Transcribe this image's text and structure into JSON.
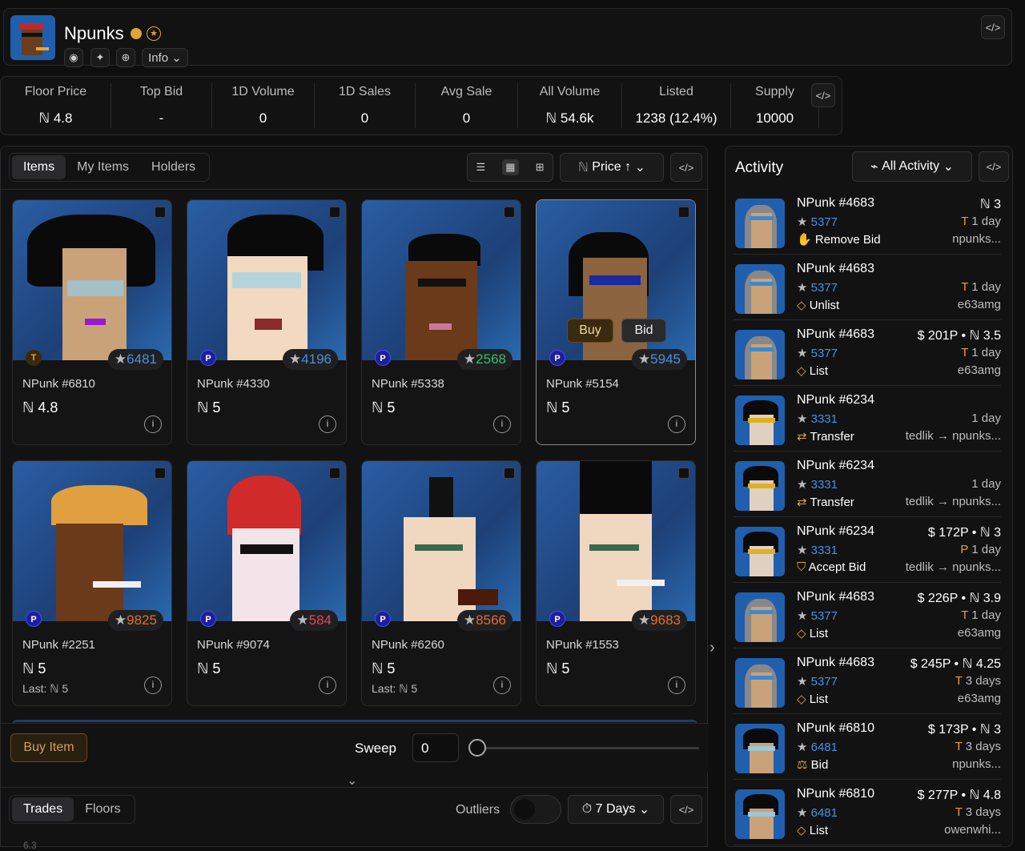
{
  "header": {
    "title": "Npunks",
    "info_label": "Info"
  },
  "stats": [
    {
      "label": "Floor Price",
      "value": "ℕ 4.8"
    },
    {
      "label": "Top Bid",
      "value": "-"
    },
    {
      "label": "1D Volume",
      "value": "0"
    },
    {
      "label": "1D Sales",
      "value": "0"
    },
    {
      "label": "Avg Sale",
      "value": "0"
    },
    {
      "label": "All Volume",
      "value": "ℕ 54.6k"
    },
    {
      "label": "Listed",
      "value": "1238 (12.4%)"
    },
    {
      "label": "Supply",
      "value": "10000"
    }
  ],
  "tabs": [
    "Items",
    "My Items",
    "Holders"
  ],
  "sort_label": "Price ↑",
  "cards": [
    {
      "name": "NPunk #6810",
      "rank": "6481",
      "rank_color": "#4a90e2",
      "price": "ℕ 4.8",
      "market": "T",
      "last": ""
    },
    {
      "name": "NPunk #4330",
      "rank": "4196",
      "rank_color": "#4a90e2",
      "price": "ℕ 5",
      "market": "P",
      "last": ""
    },
    {
      "name": "NPunk #5338",
      "rank": "2568",
      "rank_color": "#34c06a",
      "price": "ℕ 5",
      "market": "P",
      "last": ""
    },
    {
      "name": "NPunk #5154",
      "rank": "5945",
      "rank_color": "#4a90e2",
      "price": "ℕ 5",
      "market": "P",
      "last": ""
    },
    {
      "name": "NPunk #2251",
      "rank": "9825",
      "rank_color": "#e0702a",
      "price": "ℕ 5",
      "market": "P",
      "last": "Last: ℕ 5"
    },
    {
      "name": "NPunk #9074",
      "rank": "584",
      "rank_color": "#e04a5a",
      "price": "ℕ 5",
      "market": "P",
      "last": ""
    },
    {
      "name": "NPunk #6260",
      "rank": "8566",
      "rank_color": "#e0702a",
      "price": "ℕ 5",
      "market": "P",
      "last": "Last: ℕ 5"
    },
    {
      "name": "NPunk #1553",
      "rank": "9683",
      "rank_color": "#e0702a",
      "price": "ℕ 5",
      "market": "P",
      "last": ""
    }
  ],
  "hover": {
    "buy": "Buy",
    "bid": "Bid"
  },
  "footer": {
    "buy_item": "Buy Item",
    "sweep": "Sweep",
    "sweep_value": "0"
  },
  "bottom": {
    "tabs": [
      "Trades",
      "Floors"
    ],
    "outliers": "Outliers",
    "period": "7 Days",
    "axis_hint": "6.3"
  },
  "activity": {
    "title": "Activity",
    "filter": "All Activity",
    "rows": [
      {
        "name": "NPunk #4683",
        "rank": "5377",
        "type": "Remove Bid",
        "r1": "ℕ 3",
        "r2": "1 day",
        "r3": "npunks..."
      },
      {
        "name": "NPunk #4683",
        "rank": "5377",
        "type": "Unlist",
        "r1": "",
        "r2": "1 day",
        "r3": "e63amg"
      },
      {
        "name": "NPunk #4683",
        "rank": "5377",
        "type": "List",
        "r1": "$ 201P • ℕ 3.5",
        "r2": "1 day",
        "r3": "e63amg"
      },
      {
        "name": "NPunk #6234",
        "rank": "3331",
        "type": "Transfer",
        "r1": "",
        "r2": "1 day",
        "r3": "tedlik → npunks..."
      },
      {
        "name": "NPunk #6234",
        "rank": "3331",
        "type": "Transfer",
        "r1": "",
        "r2": "1 day",
        "r3": "tedlik → npunks..."
      },
      {
        "name": "NPunk #6234",
        "rank": "3331",
        "type": "Accept Bid",
        "r1": "$ 172P • ℕ 3",
        "r2": "1 day",
        "r3": "tedlik → npunks..."
      },
      {
        "name": "NPunk #4683",
        "rank": "5377",
        "type": "List",
        "r1": "$ 226P • ℕ 3.9",
        "r2": "1 day",
        "r3": "e63amg"
      },
      {
        "name": "NPunk #4683",
        "rank": "5377",
        "type": "List",
        "r1": "$ 245P • ℕ 4.25",
        "r2": "3 days",
        "r3": "e63amg"
      },
      {
        "name": "NPunk #6810",
        "rank": "6481",
        "type": "Bid",
        "r1": "$ 173P • ℕ 3",
        "r2": "3 days",
        "r3": "npunks..."
      },
      {
        "name": "NPunk #6810",
        "rank": "6481",
        "type": "List",
        "r1": "$ 277P • ℕ 4.8",
        "r2": "3 days",
        "r3": "owenwhi..."
      }
    ]
  }
}
